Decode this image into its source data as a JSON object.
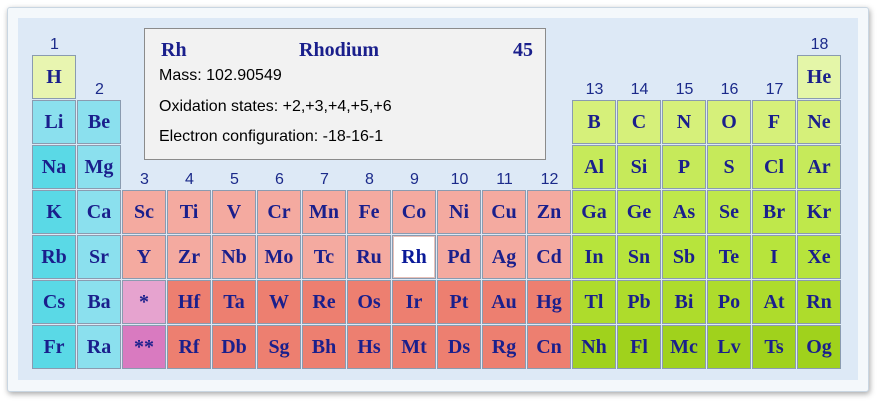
{
  "info": {
    "symbol": "Rh",
    "name": "Rhodium",
    "number": "45",
    "mass": "Mass: 102.90549",
    "oxidation": "Oxidation states: +2,+3,+4,+5,+6",
    "config": "Electron configuration: -18-16-1"
  },
  "groups": [
    "1",
    "2",
    "3",
    "4",
    "5",
    "6",
    "7",
    "8",
    "9",
    "10",
    "11",
    "12",
    "13",
    "14",
    "15",
    "16",
    "17",
    "18"
  ],
  "colors": {
    "alkali": "#5ad9e6",
    "alkaline": "#8be0ee",
    "transition": "#ed7f70",
    "transition_light": "#f4aaa0",
    "lanthanide": "#e6a3cf",
    "actinide": "#d97ac0",
    "hydrogen": "#e8f5b0",
    "p_period2": "#d6f07a",
    "p_period3": "#c6ea5a",
    "p_period4": "#bfe84b",
    "p_period5": "#b7e43c",
    "p_period6": "#aedc2c",
    "p_period7": "#a0d21c",
    "helium": "#e4f6a8"
  },
  "elements": [
    {
      "s": "H",
      "g": 1,
      "p": 1,
      "c": "hydrogen"
    },
    {
      "s": "He",
      "g": 18,
      "p": 1,
      "c": "helium"
    },
    {
      "s": "Li",
      "g": 1,
      "p": 2,
      "c": "alkaline"
    },
    {
      "s": "Be",
      "g": 2,
      "p": 2,
      "c": "alkaline"
    },
    {
      "s": "B",
      "g": 13,
      "p": 2,
      "c": "p_period2"
    },
    {
      "s": "C",
      "g": 14,
      "p": 2,
      "c": "p_period2"
    },
    {
      "s": "N",
      "g": 15,
      "p": 2,
      "c": "p_period2"
    },
    {
      "s": "O",
      "g": 16,
      "p": 2,
      "c": "p_period2"
    },
    {
      "s": "F",
      "g": 17,
      "p": 2,
      "c": "p_period2"
    },
    {
      "s": "Ne",
      "g": 18,
      "p": 2,
      "c": "p_period2"
    },
    {
      "s": "Na",
      "g": 1,
      "p": 3,
      "c": "alkali"
    },
    {
      "s": "Mg",
      "g": 2,
      "p": 3,
      "c": "alkaline"
    },
    {
      "s": "Al",
      "g": 13,
      "p": 3,
      "c": "p_period3"
    },
    {
      "s": "Si",
      "g": 14,
      "p": 3,
      "c": "p_period3"
    },
    {
      "s": "P",
      "g": 15,
      "p": 3,
      "c": "p_period3"
    },
    {
      "s": "S",
      "g": 16,
      "p": 3,
      "c": "p_period3"
    },
    {
      "s": "Cl",
      "g": 17,
      "p": 3,
      "c": "p_period3"
    },
    {
      "s": "Ar",
      "g": 18,
      "p": 3,
      "c": "p_period3"
    },
    {
      "s": "K",
      "g": 1,
      "p": 4,
      "c": "alkali"
    },
    {
      "s": "Ca",
      "g": 2,
      "p": 4,
      "c": "alkaline"
    },
    {
      "s": "Sc",
      "g": 3,
      "p": 4,
      "c": "transition_light"
    },
    {
      "s": "Ti",
      "g": 4,
      "p": 4,
      "c": "transition_light"
    },
    {
      "s": "V",
      "g": 5,
      "p": 4,
      "c": "transition_light"
    },
    {
      "s": "Cr",
      "g": 6,
      "p": 4,
      "c": "transition_light"
    },
    {
      "s": "Mn",
      "g": 7,
      "p": 4,
      "c": "transition_light"
    },
    {
      "s": "Fe",
      "g": 8,
      "p": 4,
      "c": "transition_light"
    },
    {
      "s": "Co",
      "g": 9,
      "p": 4,
      "c": "transition_light"
    },
    {
      "s": "Ni",
      "g": 10,
      "p": 4,
      "c": "transition_light"
    },
    {
      "s": "Cu",
      "g": 11,
      "p": 4,
      "c": "transition_light"
    },
    {
      "s": "Zn",
      "g": 12,
      "p": 4,
      "c": "transition_light"
    },
    {
      "s": "Ga",
      "g": 13,
      "p": 4,
      "c": "p_period4"
    },
    {
      "s": "Ge",
      "g": 14,
      "p": 4,
      "c": "p_period4"
    },
    {
      "s": "As",
      "g": 15,
      "p": 4,
      "c": "p_period4"
    },
    {
      "s": "Se",
      "g": 16,
      "p": 4,
      "c": "p_period4"
    },
    {
      "s": "Br",
      "g": 17,
      "p": 4,
      "c": "p_period4"
    },
    {
      "s": "Kr",
      "g": 18,
      "p": 4,
      "c": "p_period4"
    },
    {
      "s": "Rb",
      "g": 1,
      "p": 5,
      "c": "alkali"
    },
    {
      "s": "Sr",
      "g": 2,
      "p": 5,
      "c": "alkaline"
    },
    {
      "s": "Y",
      "g": 3,
      "p": 5,
      "c": "transition_light"
    },
    {
      "s": "Zr",
      "g": 4,
      "p": 5,
      "c": "transition_light"
    },
    {
      "s": "Nb",
      "g": 5,
      "p": 5,
      "c": "transition_light"
    },
    {
      "s": "Mo",
      "g": 6,
      "p": 5,
      "c": "transition_light"
    },
    {
      "s": "Tc",
      "g": 7,
      "p": 5,
      "c": "transition_light"
    },
    {
      "s": "Ru",
      "g": 8,
      "p": 5,
      "c": "transition_light"
    },
    {
      "s": "Rh",
      "g": 9,
      "p": 5,
      "c": "transition_light",
      "sel": true
    },
    {
      "s": "Pd",
      "g": 10,
      "p": 5,
      "c": "transition_light"
    },
    {
      "s": "Ag",
      "g": 11,
      "p": 5,
      "c": "transition_light"
    },
    {
      "s": "Cd",
      "g": 12,
      "p": 5,
      "c": "transition_light"
    },
    {
      "s": "In",
      "g": 13,
      "p": 5,
      "c": "p_period5"
    },
    {
      "s": "Sn",
      "g": 14,
      "p": 5,
      "c": "p_period5"
    },
    {
      "s": "Sb",
      "g": 15,
      "p": 5,
      "c": "p_period5"
    },
    {
      "s": "Te",
      "g": 16,
      "p": 5,
      "c": "p_period5"
    },
    {
      "s": "I",
      "g": 17,
      "p": 5,
      "c": "p_period5"
    },
    {
      "s": "Xe",
      "g": 18,
      "p": 5,
      "c": "p_period5"
    },
    {
      "s": "Cs",
      "g": 1,
      "p": 6,
      "c": "alkali"
    },
    {
      "s": "Ba",
      "g": 2,
      "p": 6,
      "c": "alkaline"
    },
    {
      "s": "*",
      "g": 3,
      "p": 6,
      "c": "lanthanide"
    },
    {
      "s": "Hf",
      "g": 4,
      "p": 6,
      "c": "transition"
    },
    {
      "s": "Ta",
      "g": 5,
      "p": 6,
      "c": "transition"
    },
    {
      "s": "W",
      "g": 6,
      "p": 6,
      "c": "transition"
    },
    {
      "s": "Re",
      "g": 7,
      "p": 6,
      "c": "transition"
    },
    {
      "s": "Os",
      "g": 8,
      "p": 6,
      "c": "transition"
    },
    {
      "s": "Ir",
      "g": 9,
      "p": 6,
      "c": "transition"
    },
    {
      "s": "Pt",
      "g": 10,
      "p": 6,
      "c": "transition"
    },
    {
      "s": "Au",
      "g": 11,
      "p": 6,
      "c": "transition"
    },
    {
      "s": "Hg",
      "g": 12,
      "p": 6,
      "c": "transition"
    },
    {
      "s": "Tl",
      "g": 13,
      "p": 6,
      "c": "p_period6"
    },
    {
      "s": "Pb",
      "g": 14,
      "p": 6,
      "c": "p_period6"
    },
    {
      "s": "Bi",
      "g": 15,
      "p": 6,
      "c": "p_period6"
    },
    {
      "s": "Po",
      "g": 16,
      "p": 6,
      "c": "p_period6"
    },
    {
      "s": "At",
      "g": 17,
      "p": 6,
      "c": "p_period6"
    },
    {
      "s": "Rn",
      "g": 18,
      "p": 6,
      "c": "p_period6"
    },
    {
      "s": "Fr",
      "g": 1,
      "p": 7,
      "c": "alkali"
    },
    {
      "s": "Ra",
      "g": 2,
      "p": 7,
      "c": "alkaline"
    },
    {
      "s": "**",
      "g": 3,
      "p": 7,
      "c": "actinide"
    },
    {
      "s": "Rf",
      "g": 4,
      "p": 7,
      "c": "transition"
    },
    {
      "s": "Db",
      "g": 5,
      "p": 7,
      "c": "transition"
    },
    {
      "s": "Sg",
      "g": 6,
      "p": 7,
      "c": "transition"
    },
    {
      "s": "Bh",
      "g": 7,
      "p": 7,
      "c": "transition"
    },
    {
      "s": "Hs",
      "g": 8,
      "p": 7,
      "c": "transition"
    },
    {
      "s": "Mt",
      "g": 9,
      "p": 7,
      "c": "transition"
    },
    {
      "s": "Ds",
      "g": 10,
      "p": 7,
      "c": "transition"
    },
    {
      "s": "Rg",
      "g": 11,
      "p": 7,
      "c": "transition"
    },
    {
      "s": "Cn",
      "g": 12,
      "p": 7,
      "c": "transition"
    },
    {
      "s": "Nh",
      "g": 13,
      "p": 7,
      "c": "p_period7"
    },
    {
      "s": "Fl",
      "g": 14,
      "p": 7,
      "c": "p_period7"
    },
    {
      "s": "Mc",
      "g": 15,
      "p": 7,
      "c": "p_period7"
    },
    {
      "s": "Lv",
      "g": 16,
      "p": 7,
      "c": "p_period7"
    },
    {
      "s": "Ts",
      "g": 17,
      "p": 7,
      "c": "p_period7"
    },
    {
      "s": "Og",
      "g": 18,
      "p": 7,
      "c": "p_period7"
    }
  ]
}
